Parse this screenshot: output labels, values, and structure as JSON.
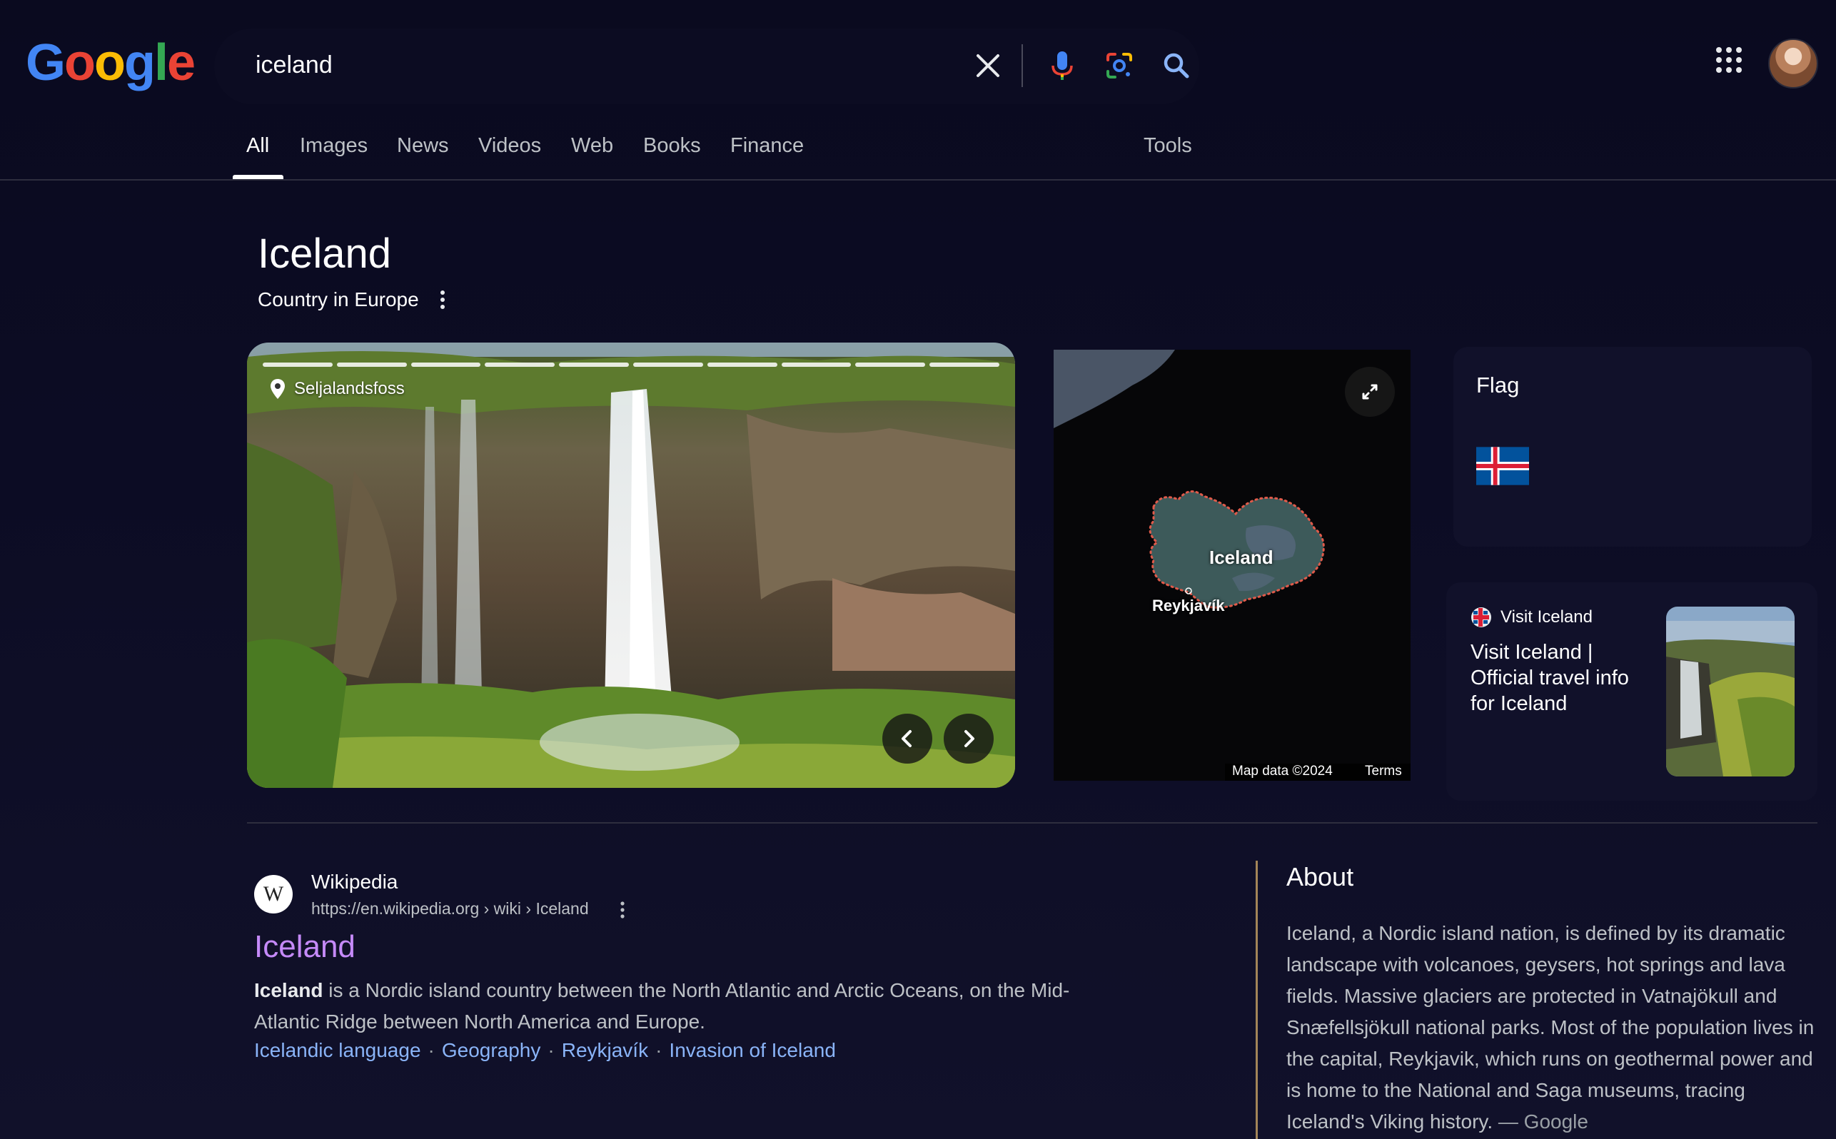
{
  "header": {
    "logo_text": "Google",
    "search_query": "iceland"
  },
  "tabs": [
    {
      "label": "All",
      "active": true
    },
    {
      "label": "Images",
      "active": false
    },
    {
      "label": "News",
      "active": false
    },
    {
      "label": "Videos",
      "active": false
    },
    {
      "label": "Web",
      "active": false
    },
    {
      "label": "Books",
      "active": false
    },
    {
      "label": "Finance",
      "active": false
    }
  ],
  "tools_label": "Tools",
  "knowledge": {
    "title": "Iceland",
    "subtitle": "Country in Europe",
    "photo_location": "Seljalandsfoss",
    "photo_count": 10,
    "map": {
      "country_label": "Iceland",
      "city_label": "Reykjavík",
      "data_label": "Map data ©2024",
      "terms_label": "Terms"
    },
    "flag": {
      "title": "Flag"
    },
    "visit": {
      "source": "Visit Iceland",
      "title": "Visit Iceland | Official travel info for Iceland"
    }
  },
  "result": {
    "favicon_letter": "W",
    "site_name": "Wikipedia",
    "url": "https://en.wikipedia.org › wiki › Iceland",
    "title": "Iceland",
    "snippet_bold": "Iceland",
    "snippet_rest": " is a Nordic island country between the North Atlantic and Arctic Oceans, on the Mid-Atlantic Ridge between North America and Europe.",
    "links": [
      "Icelandic language",
      "Geography",
      "Reykjavík",
      "Invasion of Iceland"
    ],
    "link_separator": "·"
  },
  "about": {
    "title": "About",
    "text": "Iceland, a Nordic island nation, is defined by its dramatic landscape with volcanoes, geysers, hot springs and lava fields. Massive glaciers are protected in Vatnajökull and Snæfellsjökull national parks. Most of the population lives in the capital, Reykjavik, which runs on geothermal power and is home to the National and Saga museums, tracing Iceland's Viking history.",
    "source": "— Google"
  },
  "colors": {
    "background": "#0b0b1f",
    "link_blue": "#8ab4f8",
    "visited_purple": "#c58af9",
    "about_accent": "#c8a264"
  }
}
